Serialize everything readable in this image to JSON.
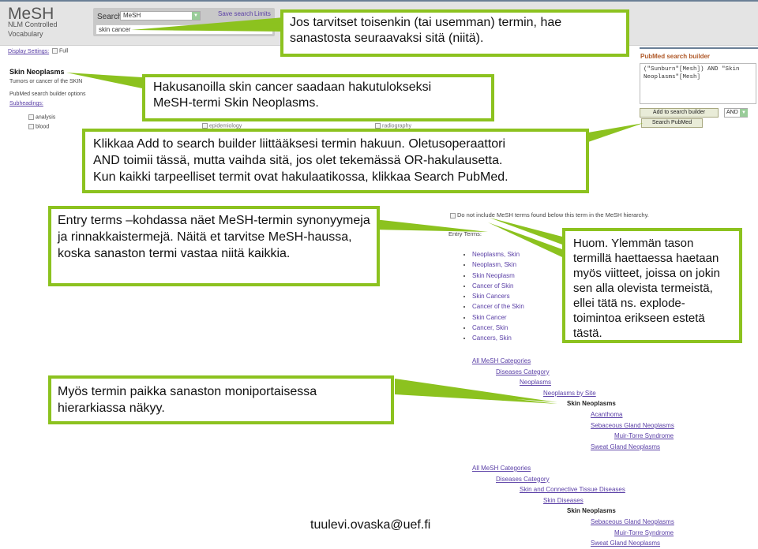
{
  "header": {
    "app_title": "MeSH",
    "app_subtitle_line1": "NLM Controlled",
    "app_subtitle_line2": "Vocabulary",
    "search_label": "Search",
    "search_db": "MeSH",
    "search_query": "skin cancer",
    "links": [
      "Save search",
      "Limits"
    ]
  },
  "display_settings": {
    "label": "Display Settings:",
    "value": "Full"
  },
  "term": {
    "title": "Skin Neoplasms",
    "description": "Tumors or cancer of the SKIN",
    "builder_options": "PubMed search builder options",
    "subheadings_label": "Subheadings:",
    "subheadings": [
      "analysis",
      "blood",
      "epidemiology",
      "radiography"
    ]
  },
  "search_builder": {
    "title": "PubMed search builder",
    "query": "(\"Sunburn\"[Mesh]) AND \"Skin Neoplasms\"[Mesh]",
    "add_button": "Add to search builder",
    "operator": "AND",
    "search_button": "Search PubMed"
  },
  "callouts": {
    "c1": "Jos tarvitset toisenkin (tai usemman) termin, hae sanastosta seuraavaksi sitä (niitä).",
    "c2_line1": "Hakusanoilla skin cancer saadaan hakutulokseksi",
    "c2_line2": "MeSH-termi Skin Neoplasms.",
    "c3_line1": "Klikkaa Add to search builder liittääksesi termin hakuun. Oletusoperaattori",
    "c3_line2": "AND toimii tässä, mutta vaihda sitä, jos olet tekemässä OR-hakulausetta.",
    "c3_line3": "Kun kaikki tarpeelliset termit ovat hakulaatikossa, klikkaa Search PubMed.",
    "c4": "Entry terms –kohdassa näet MeSH-termin synonyymeja ja rinnakkaistermejä. Näitä et tarvitse MeSH-haussa, koska sanaston termi vastaa niitä kaikkia.",
    "c5": "Huom. Ylemmän tason termillä haettaessa haetaan myös viitteet, joissa on jokin sen alla olevista termeistä, ellei tätä ns. explode-toimintoa erikseen estetä tästä.",
    "c6": "Myös termin paikka sanaston moniportaisessa hierarkiassa näkyy."
  },
  "entry": {
    "exclude_label": "Do not include MeSH terms found below this term in the MeSH hierarchy.",
    "heading": "Entry Terms:",
    "terms": [
      "Neoplasms, Skin",
      "Neoplasm, Skin",
      "Skin Neoplasm",
      "Cancer of Skin",
      "Skin Cancers",
      "Cancer of the Skin",
      "Skin Cancer",
      "Cancer, Skin",
      "Cancers, Skin"
    ]
  },
  "tree1": [
    {
      "label": "All MeSH Categories",
      "level": 0,
      "current": false
    },
    {
      "label": "Diseases Category",
      "level": 1,
      "current": false
    },
    {
      "label": "Neoplasms",
      "level": 2,
      "current": false
    },
    {
      "label": "Neoplasms by Site",
      "level": 3,
      "current": false
    },
    {
      "label": "Skin Neoplasms",
      "level": 4,
      "current": true
    },
    {
      "label": "Acanthoma",
      "level": 5,
      "current": false
    },
    {
      "label": "Sebaceous Gland Neoplasms",
      "level": 5,
      "current": false
    },
    {
      "label": "Muir-Torre Syndrome",
      "level": 6,
      "current": false
    },
    {
      "label": "Sweat Gland Neoplasms",
      "level": 5,
      "current": false
    }
  ],
  "tree2": [
    {
      "label": "All MeSH Categories",
      "level": 0,
      "current": false
    },
    {
      "label": "Diseases Category",
      "level": 1,
      "current": false
    },
    {
      "label": "Skin and Connective Tissue Diseases",
      "level": 2,
      "current": false
    },
    {
      "label": "Skin Diseases",
      "level": 3,
      "current": false
    },
    {
      "label": "Skin Neoplasms",
      "level": 4,
      "current": true
    },
    {
      "label": "Sebaceous Gland Neoplasms",
      "level": 5,
      "current": false
    },
    {
      "label": "Muir-Torre Syndrome",
      "level": 6,
      "current": false
    },
    {
      "label": "Sweat Gland Neoplasms",
      "level": 5,
      "current": false
    }
  ],
  "footer": {
    "email": "tuulevi.ovaska@uef.fi"
  }
}
